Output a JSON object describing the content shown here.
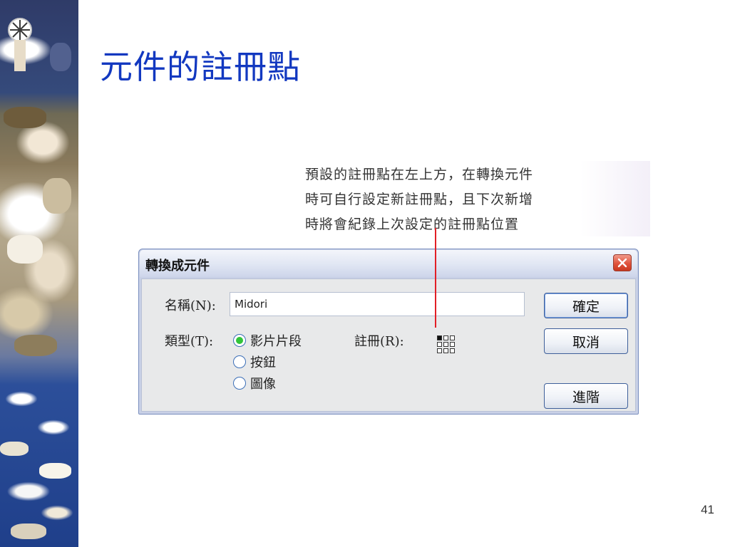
{
  "slide": {
    "title": "元件的註冊點",
    "page_number": "41"
  },
  "annotation": {
    "lines": [
      "預設的註冊點在左上方，在轉換元件",
      "時可自行設定新註冊點，且下次新增",
      "時將會紀錄上次設定的註冊點位置"
    ]
  },
  "dialog": {
    "title": "轉換成元件",
    "name_label": "名稱(N):",
    "name_value": "Midori",
    "type_label": "類型(T):",
    "type_options": [
      {
        "label": "影片片段",
        "selected": true
      },
      {
        "label": "按鈕",
        "selected": false
      },
      {
        "label": "圖像",
        "selected": false
      }
    ],
    "registration_label": "註冊(R):",
    "registration_selected": "top-left",
    "ok_label": "確定",
    "cancel_label": "取消",
    "advanced_label": "進階",
    "close_icon": "close-icon"
  },
  "colors": {
    "title": "#1238c0",
    "pointer_line": "#e21f26",
    "radio_checked": "#31c43a",
    "close_button": "#e0533c"
  }
}
